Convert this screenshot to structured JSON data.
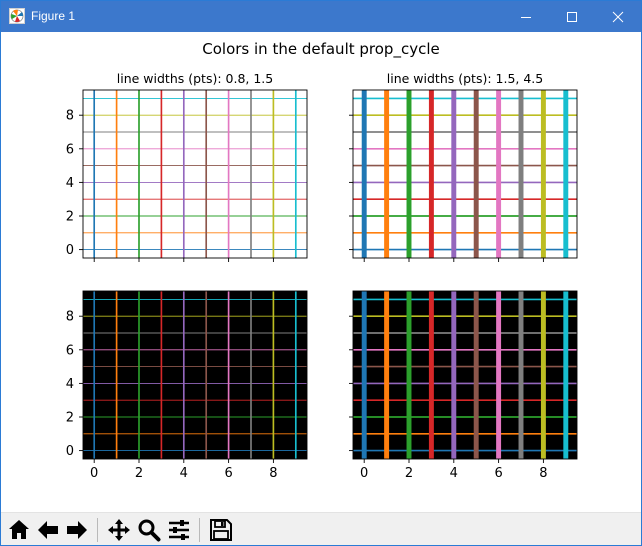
{
  "window": {
    "title": "Figure 1",
    "icons": {
      "app": "matplotlib-figure-icon",
      "minimize": "minimize-icon",
      "maximize": "maximize-icon",
      "close": "close-icon"
    }
  },
  "figure": {
    "suptitle": "Colors in the default prop_cycle"
  },
  "colors": [
    "#1f77b4",
    "#ff7f0e",
    "#2ca02c",
    "#d62728",
    "#9467bd",
    "#8c564b",
    "#e377c2",
    "#7f7f7f",
    "#bcbd22",
    "#17becf"
  ],
  "chart_data": [
    {
      "type": "line",
      "panel": "top-left",
      "title": "line widths (pts): 0.8, 1.5",
      "facecolor": "#ffffff",
      "vertical_lines_x": [
        0,
        1,
        2,
        3,
        4,
        5,
        6,
        7,
        8,
        9
      ],
      "horizontal_lines_y": [
        0,
        1,
        2,
        3,
        4,
        5,
        6,
        7,
        8,
        9
      ],
      "vertical_linewidth_pts": 1.5,
      "horizontal_linewidth_pts": 0.8,
      "xlim": [
        -0.5,
        9.5
      ],
      "ylim": [
        -0.5,
        9.5
      ],
      "xticks": [
        0,
        2,
        4,
        6,
        8
      ],
      "yticks": [
        0,
        2,
        4,
        6,
        8
      ],
      "show_x_tick_labels": false,
      "show_y_tick_labels": true
    },
    {
      "type": "line",
      "panel": "top-right",
      "title": "line widths (pts): 1.5, 4.5",
      "facecolor": "#ffffff",
      "vertical_lines_x": [
        0,
        1,
        2,
        3,
        4,
        5,
        6,
        7,
        8,
        9
      ],
      "horizontal_lines_y": [
        0,
        1,
        2,
        3,
        4,
        5,
        6,
        7,
        8,
        9
      ],
      "vertical_linewidth_pts": 4.5,
      "horizontal_linewidth_pts": 1.5,
      "xlim": [
        -0.5,
        9.5
      ],
      "ylim": [
        -0.5,
        9.5
      ],
      "xticks": [
        0,
        2,
        4,
        6,
        8
      ],
      "yticks": [
        0,
        2,
        4,
        6,
        8
      ],
      "show_x_tick_labels": false,
      "show_y_tick_labels": false
    },
    {
      "type": "line",
      "panel": "bottom-left",
      "title": "",
      "facecolor": "#000000",
      "vertical_lines_x": [
        0,
        1,
        2,
        3,
        4,
        5,
        6,
        7,
        8,
        9
      ],
      "horizontal_lines_y": [
        0,
        1,
        2,
        3,
        4,
        5,
        6,
        7,
        8,
        9
      ],
      "vertical_linewidth_pts": 1.5,
      "horizontal_linewidth_pts": 0.8,
      "xlim": [
        -0.5,
        9.5
      ],
      "ylim": [
        -0.5,
        9.5
      ],
      "xticks": [
        0,
        2,
        4,
        6,
        8
      ],
      "yticks": [
        0,
        2,
        4,
        6,
        8
      ],
      "show_x_tick_labels": true,
      "show_y_tick_labels": true
    },
    {
      "type": "line",
      "panel": "bottom-right",
      "title": "",
      "facecolor": "#000000",
      "vertical_lines_x": [
        0,
        1,
        2,
        3,
        4,
        5,
        6,
        7,
        8,
        9
      ],
      "horizontal_lines_y": [
        0,
        1,
        2,
        3,
        4,
        5,
        6,
        7,
        8,
        9
      ],
      "vertical_linewidth_pts": 4.5,
      "horizontal_linewidth_pts": 1.5,
      "xlim": [
        -0.5,
        9.5
      ],
      "ylim": [
        -0.5,
        9.5
      ],
      "xticks": [
        0,
        2,
        4,
        6,
        8
      ],
      "yticks": [
        0,
        2,
        4,
        6,
        8
      ],
      "show_x_tick_labels": true,
      "show_y_tick_labels": false
    }
  ],
  "toolbar": {
    "buttons": [
      {
        "name": "home-button",
        "icon": "home-icon"
      },
      {
        "name": "back-button",
        "icon": "arrow-left-icon"
      },
      {
        "name": "forward-button",
        "icon": "arrow-right-icon"
      },
      {
        "name": "pan-button",
        "icon": "move-icon"
      },
      {
        "name": "zoom-button",
        "icon": "magnifier-icon"
      },
      {
        "name": "configure-subplots-button",
        "icon": "sliders-icon"
      },
      {
        "name": "save-button",
        "icon": "floppy-disk-icon"
      }
    ]
  }
}
